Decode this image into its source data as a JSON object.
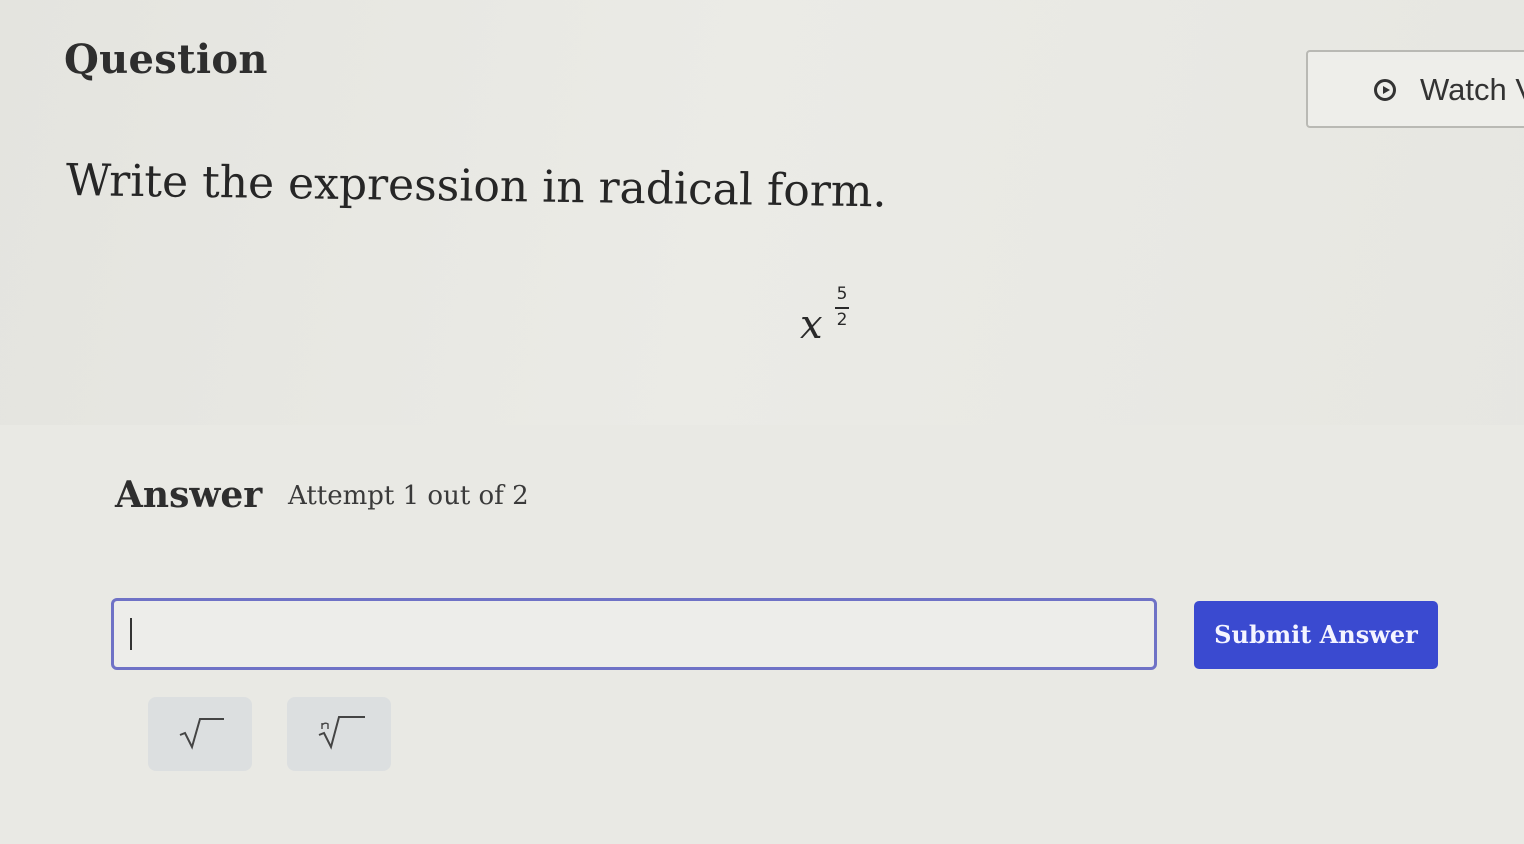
{
  "question": {
    "heading": "Question",
    "watch_label": "Watch V",
    "instruction": "Write the expression in radical form."
  },
  "expression": {
    "base": "x",
    "exponent_numerator": "5",
    "exponent_denominator": "2"
  },
  "answer": {
    "label": "Answer",
    "attempt": "Attempt 1 out of 2",
    "input_value": "",
    "submit_label": "Submit Answer"
  },
  "toolbar": {
    "buttons": [
      {
        "icon": "square-root-icon"
      },
      {
        "icon": "nth-root-icon"
      }
    ]
  }
}
